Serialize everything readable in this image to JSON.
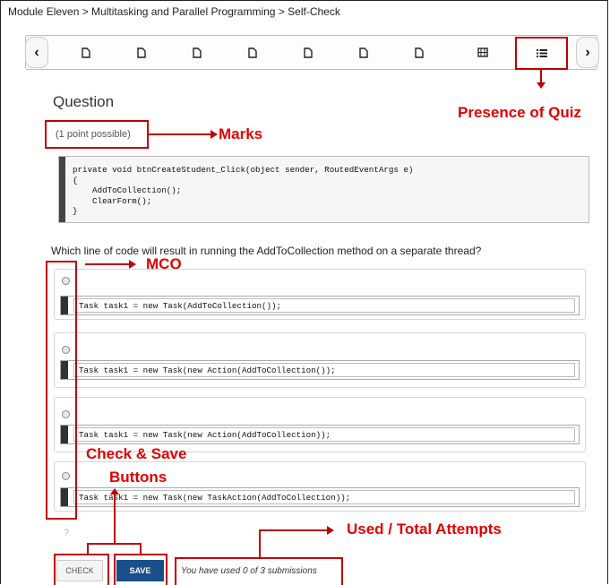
{
  "breadcrumb": {
    "items": [
      "Module Eleven",
      "Multitasking and Parallel Programming",
      "Self-Check"
    ],
    "separator": ">",
    "text": "Module Eleven > Multitasking and Parallel Programming > Self-Check"
  },
  "sequence_nav": {
    "prev_glyph": "‹",
    "next_glyph": "›",
    "items": [
      {
        "icon": "page-icon"
      },
      {
        "icon": "page-icon"
      },
      {
        "icon": "page-icon"
      },
      {
        "icon": "page-icon"
      },
      {
        "icon": "page-icon"
      },
      {
        "icon": "page-icon"
      },
      {
        "icon": "page-icon"
      },
      {
        "icon": "video-icon"
      },
      {
        "icon": "list-icon",
        "active": true
      }
    ]
  },
  "question": {
    "title": "Question",
    "points": "(1 point possible)",
    "code": "private void btnCreateStudent_Click(object sender, RoutedEventArgs e)\n{\n    AddToCollection();\n    ClearForm();\n}",
    "prompt": "Which line of code will result in running the AddToCollection method on a separate thread?",
    "choices": [
      {
        "code": "Task task1 = new Task(AddToCollection());"
      },
      {
        "code": "Task task1 = new Task(new Action(AddToCollection());"
      },
      {
        "code": "Task task1 = new Task(new Action(AddToCollection));"
      },
      {
        "code": "Task task1 = new Task(new TaskAction(AddToCollection));"
      }
    ],
    "help_glyph": "?"
  },
  "actions": {
    "check_label": "CHECK",
    "save_label": "SAVE",
    "submissions_text": "You have used 0 of 3 submissions"
  },
  "annotations": {
    "quiz": "Presence of Quiz",
    "marks": "Marks",
    "mcq": "MCQ",
    "check_save_line1": "Check & Save",
    "check_save_line2": "Buttons",
    "attempts": "Used / Total Attempts"
  },
  "colors": {
    "annotation": "#e00000",
    "save_button": "#1a4f8b"
  }
}
